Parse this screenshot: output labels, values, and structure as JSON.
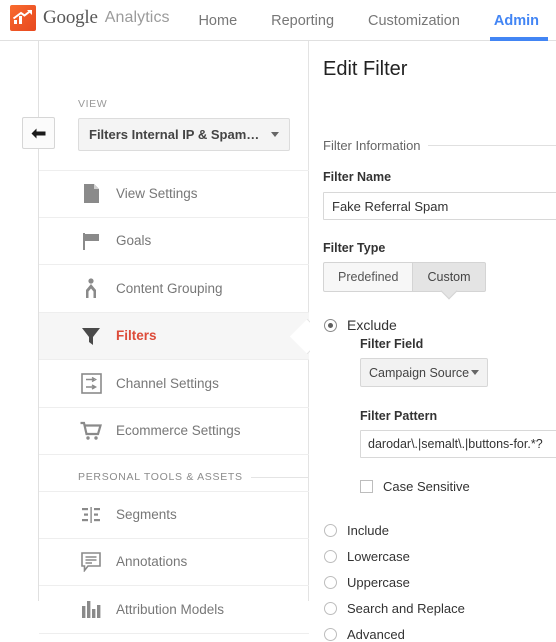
{
  "header": {
    "brand_google": "Google",
    "brand_analytics": "Analytics",
    "nav": [
      {
        "label": "Home",
        "active": false
      },
      {
        "label": "Reporting",
        "active": false
      },
      {
        "label": "Customization",
        "active": false
      },
      {
        "label": "Admin",
        "active": true
      }
    ],
    "accent_color": "#4285f4"
  },
  "sidebar": {
    "back_button": "back-arrow",
    "view_label": "VIEW",
    "view_selected": "Filters Internal IP & Spam…",
    "items": [
      {
        "label": "View Settings",
        "icon": "page-icon",
        "active": false
      },
      {
        "label": "Goals",
        "icon": "flag-icon",
        "active": false
      },
      {
        "label": "Content Grouping",
        "icon": "content-grouping-icon",
        "active": false
      },
      {
        "label": "Filters",
        "icon": "funnel-icon",
        "active": true
      },
      {
        "label": "Channel Settings",
        "icon": "channel-settings-icon",
        "active": false
      },
      {
        "label": "Ecommerce Settings",
        "icon": "cart-icon",
        "active": false
      }
    ],
    "section_title": "PERSONAL TOOLS & ASSETS",
    "personal_items": [
      {
        "label": "Segments",
        "icon": "segments-icon",
        "active": false
      },
      {
        "label": "Annotations",
        "icon": "annotations-icon",
        "active": false
      },
      {
        "label": "Attribution Models",
        "icon": "attribution-icon",
        "active": false
      }
    ],
    "active_color": "#dd4b39"
  },
  "main": {
    "title": "Edit Filter",
    "section_legend": "Filter Information",
    "filter_name_label": "Filter Name",
    "filter_name_value": "Fake Referral Spam",
    "filter_type_label": "Filter Type",
    "tabs": [
      {
        "label": "Predefined",
        "selected": false
      },
      {
        "label": "Custom",
        "selected": true
      }
    ],
    "exclude_label": "Exclude",
    "exclude_selected": true,
    "filter_field_label": "Filter Field",
    "filter_field_value": "Campaign Source",
    "filter_pattern_label": "Filter Pattern",
    "filter_pattern_value": "darodar\\.|semalt\\.|buttons-for.*?",
    "case_sensitive_label": "Case Sensitive",
    "case_sensitive_checked": false,
    "other_options": [
      {
        "label": "Include",
        "selected": false
      },
      {
        "label": "Lowercase",
        "selected": false
      },
      {
        "label": "Uppercase",
        "selected": false
      },
      {
        "label": "Search and Replace",
        "selected": false
      },
      {
        "label": "Advanced",
        "selected": false
      }
    ]
  }
}
